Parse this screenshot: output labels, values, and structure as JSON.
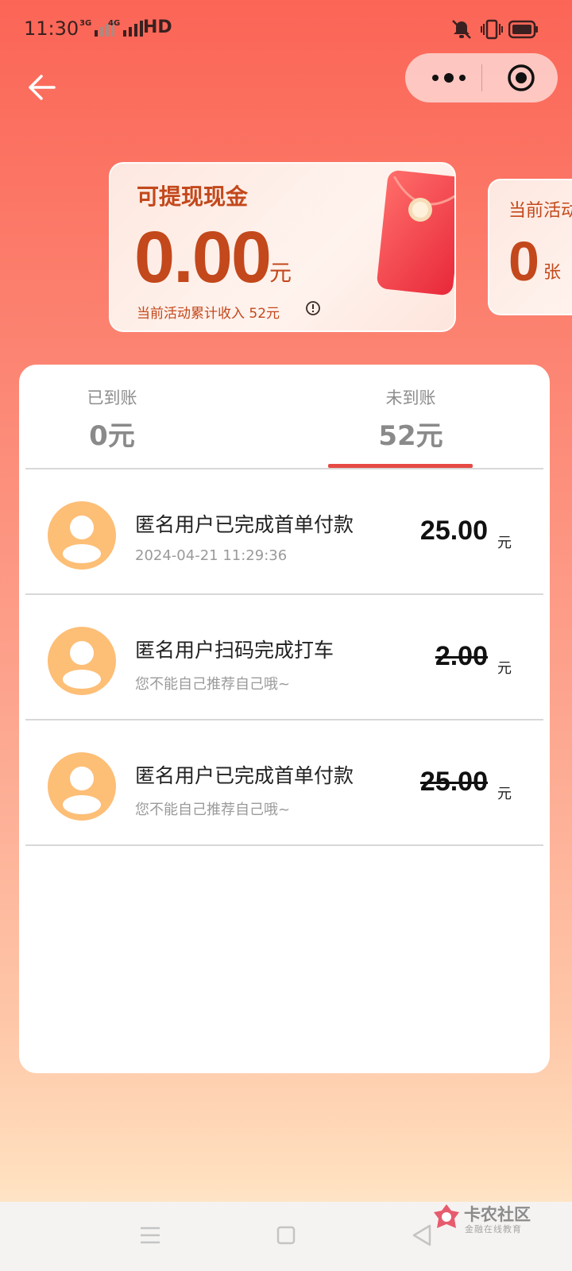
{
  "status_bar": {
    "time": "11:30",
    "network_1": "3G",
    "network_2": "4G",
    "hd": "HD",
    "icons": [
      "mute-icon",
      "vibrate-icon",
      "battery-icon"
    ]
  },
  "header": {
    "back_icon": "back-arrow-icon",
    "more_icon": "more-dots-icon",
    "close_icon": "target-circle-icon"
  },
  "cash_card": {
    "title": "可提现现金",
    "amount": "0.00",
    "unit": "元",
    "subtitle": "当前活动累计收入 52元",
    "info_icon": "info-icon"
  },
  "coupon_card": {
    "title": "当前活动",
    "count": "0",
    "unit": "张"
  },
  "tabs": [
    {
      "label": "已到账",
      "value": "0元",
      "selected": false
    },
    {
      "label": "未到账",
      "value": "52元",
      "selected": true
    }
  ],
  "records": [
    {
      "title": "匿名用户已完成首单付款",
      "subtitle": "2024-04-21 11:29:36",
      "amount": "25.00",
      "unit": "元",
      "struck": false
    },
    {
      "title": "匿名用户扫码完成打车",
      "subtitle": "您不能自己推荐自己哦~",
      "amount": "2.00",
      "unit": "元",
      "struck": true
    },
    {
      "title": "匿名用户已完成首单付款",
      "subtitle": "您不能自己推荐自己哦~",
      "amount": "25.00",
      "unit": "元",
      "struck": true
    }
  ],
  "watermark": {
    "title": "卡农社区",
    "subtitle": "金融在线教育"
  },
  "colors": {
    "accent": "#e64a44",
    "cash_text": "#c3481b",
    "avatar": "#fdbe76"
  }
}
